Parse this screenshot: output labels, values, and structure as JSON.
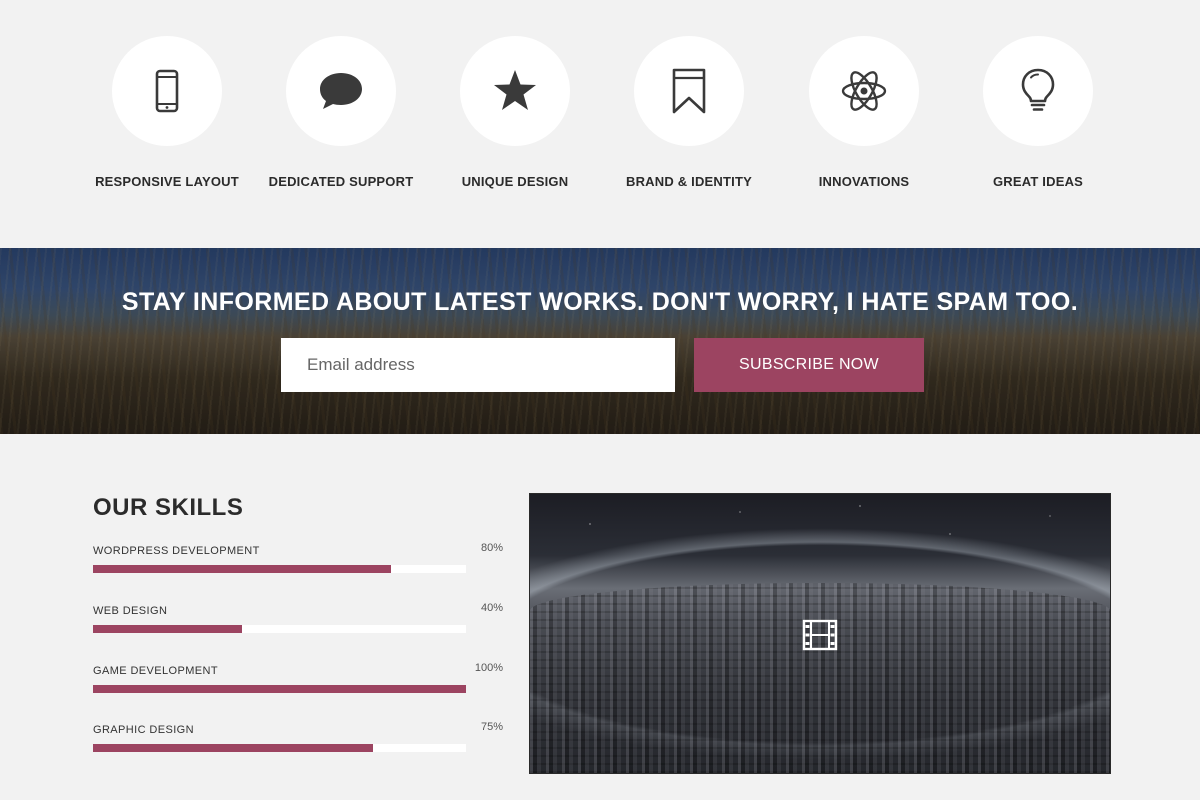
{
  "features": [
    {
      "label": "RESPONSIVE LAYOUT",
      "icon": "smartphone-icon"
    },
    {
      "label": "DEDICATED SUPPORT",
      "icon": "speech-bubble-icon"
    },
    {
      "label": "UNIQUE DESIGN",
      "icon": "star-icon"
    },
    {
      "label": "BRAND & IDENTITY",
      "icon": "bookmark-icon"
    },
    {
      "label": "INNOVATIONS",
      "icon": "atom-icon"
    },
    {
      "label": "GREAT IDEAS",
      "icon": "lightbulb-icon"
    }
  ],
  "subscribe": {
    "headline": "STAY INFORMED ABOUT LATEST WORKS. DON'T WORRY, I HATE SPAM TOO.",
    "email_placeholder": "Email address",
    "button_label": "SUBSCRIBE NOW"
  },
  "skills": {
    "title": "OUR SKILLS",
    "items": [
      {
        "name": "WORDPRESS DEVELOPMENT",
        "percent_label": "80%",
        "value": 80
      },
      {
        "name": "WEB DESIGN",
        "percent_label": "40%",
        "value": 40
      },
      {
        "name": "GAME DEVELOPMENT",
        "percent_label": "100%",
        "value": 100
      },
      {
        "name": "GRAPHIC DESIGN",
        "percent_label": "75%",
        "value": 75
      }
    ]
  },
  "video": {
    "icon": "film-icon"
  },
  "colors": {
    "accent": "#9c4461",
    "background": "#f2f2f2",
    "icon": "#3a3a3a"
  }
}
